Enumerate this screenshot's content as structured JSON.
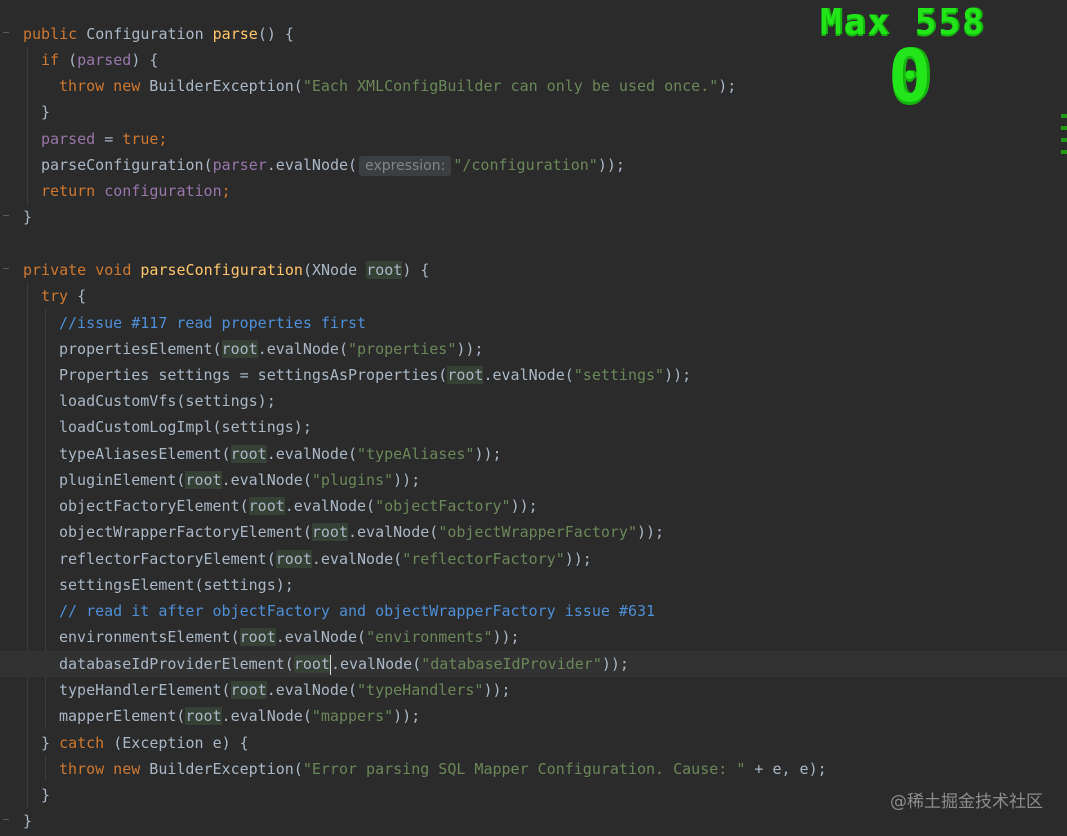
{
  "overlay": {
    "max_label": "Max 558",
    "counter_value": "0"
  },
  "watermark": "@稀土掘金技术社区",
  "colors": {
    "background": "#2b2b2b",
    "keyword": "#cc7832",
    "method": "#ffc66d",
    "string": "#6a8759",
    "field": "#9876aa",
    "comment": "#629755",
    "counter": "#22e61a"
  },
  "code": {
    "l1": {
      "kw_public": "public",
      "type": " Configuration ",
      "fn": "parse",
      "rest": "() {"
    },
    "l2": {
      "kw": "if",
      "open": " (",
      "fld": "parsed",
      "close": ") {"
    },
    "l3": {
      "kw": "throw new",
      "cls": " BuilderException(",
      "str": "\"Each XMLConfigBuilder can only be used once.\"",
      "close": ");"
    },
    "l4": {
      "text": "}"
    },
    "l5": {
      "fld": "parsed",
      "eq": " = ",
      "kw": "true",
      "semi": ";"
    },
    "l6": {
      "fn": "parseConfiguration",
      "p1": "(",
      "fld": "parser",
      "m": ".evalNode(",
      "hint": "expression:",
      "str": "\"/configuration\"",
      "close": "));"
    },
    "l7": {
      "kw": "return",
      "sp": " ",
      "fld": "configuration",
      "semi": ";"
    },
    "l8": {
      "text": "}"
    },
    "l9": {
      "kw_private": "private void",
      "sp": " ",
      "fn": "parseConfiguration",
      "p": "(XNode ",
      "param": "root",
      "close": ") {"
    },
    "l10": {
      "kw": "try",
      "brace": " {"
    },
    "l11": {
      "cmt": "//issue #117 read properties first"
    },
    "l12": {
      "m": "propertiesElement(",
      "r": "root",
      "e": ".evalNode(",
      "str": "\"properties\"",
      "c": "));"
    },
    "l13": {
      "m": "Properties settings = settingsAsProperties(",
      "r": "root",
      "e": ".evalNode(",
      "str": "\"settings\"",
      "c": "));"
    },
    "l14": {
      "text": "loadCustomVfs(settings);"
    },
    "l15": {
      "text": "loadCustomLogImpl(settings);"
    },
    "l16": {
      "m": "typeAliasesElement(",
      "r": "root",
      "e": ".evalNode(",
      "str": "\"typeAliases\"",
      "c": "));"
    },
    "l17": {
      "m": "pluginElement(",
      "r": "root",
      "e": ".evalNode(",
      "str": "\"plugins\"",
      "c": "));"
    },
    "l18": {
      "m": "objectFactoryElement(",
      "r": "root",
      "e": ".evalNode(",
      "str": "\"objectFactory\"",
      "c": "));"
    },
    "l19": {
      "m": "objectWrapperFactoryElement(",
      "r": "root",
      "e": ".evalNode(",
      "str": "\"objectWrapperFactory\"",
      "c": "));"
    },
    "l20": {
      "m": "reflectorFactoryElement(",
      "r": "root",
      "e": ".evalNode(",
      "str": "\"reflectorFactory\"",
      "c": "));"
    },
    "l21": {
      "text": "settingsElement(settings);"
    },
    "l22": {
      "cmt": "// read it after objectFactory and objectWrapperFactory issue #631"
    },
    "l23": {
      "m": "environmentsElement(",
      "r": "root",
      "e": ".evalNode(",
      "str": "\"environments\"",
      "c": "));"
    },
    "l24": {
      "m": "databaseIdProviderElement(",
      "r1": "root",
      "e": ".evalNode(",
      "str": "\"databaseIdProvider\"",
      "c": "));"
    },
    "l25": {
      "m": "typeHandlerElement(",
      "r": "root",
      "e": ".evalNode(",
      "str": "\"typeHandlers\"",
      "c": "));"
    },
    "l26": {
      "m": "mapperElement(",
      "r": "root",
      "e": ".evalNode(",
      "str": "\"mappers\"",
      "c": "));"
    },
    "l27": {
      "b": "} ",
      "kw": "catch",
      "rest": " (Exception e) {"
    },
    "l28": {
      "kw": "throw new",
      "cls": " BuilderException(",
      "str": "\"Error parsing SQL Mapper Configuration. Cause: \"",
      "rest": " + e, e);"
    },
    "l29": {
      "text": "}"
    },
    "l30": {
      "text": "}"
    }
  }
}
